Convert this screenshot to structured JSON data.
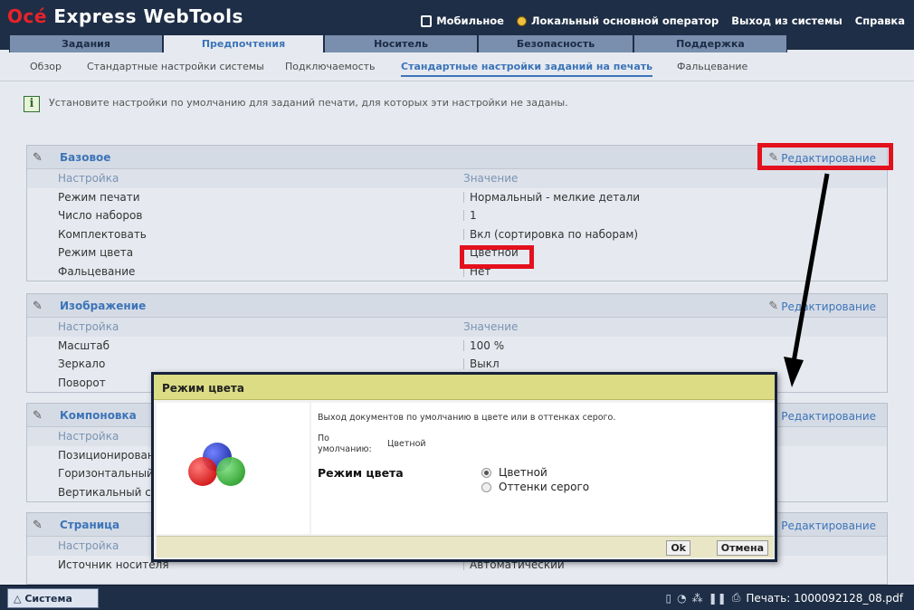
{
  "app": {
    "logo_brand": "Océ",
    "logo_product": "Express WebTools"
  },
  "topmenu": {
    "mobile": "Мобильное",
    "operator": "Локальный основной оператор",
    "logout": "Выход из системы",
    "help": "Справка"
  },
  "tabs": [
    "Задания",
    "Предпочтения",
    "Носитель",
    "Безопасность",
    "Поддержка"
  ],
  "subtabs": [
    "Обзор",
    "Стандартные настройки системы",
    "Подключаемость",
    "Стандартные настройки заданий на печать",
    "Фальцевание"
  ],
  "info_text": "Установите настройки по умолчанию для заданий печати, для которых эти настройки не заданы.",
  "edit_label": "Редактирование",
  "col_setting": "Настройка",
  "col_value": "Значение",
  "sections": {
    "basic": {
      "title": "Базовое",
      "rows": [
        {
          "k": "Режим печати",
          "v": "Нормальный - мелкие детали"
        },
        {
          "k": "Число наборов",
          "v": "1"
        },
        {
          "k": "Комплектовать",
          "v": "Вкл (сортировка по наборам)"
        },
        {
          "k": "Режим цвета",
          "v": "Цветной"
        },
        {
          "k": "Фальцевание",
          "v": "Нет"
        }
      ]
    },
    "image": {
      "title": "Изображение",
      "rows": [
        {
          "k": "Масштаб",
          "v": "100 %"
        },
        {
          "k": "Зеркало",
          "v": "Выкл"
        },
        {
          "k": "Поворот",
          "v": ""
        }
      ]
    },
    "layout": {
      "title": "Компоновка",
      "rows": [
        {
          "k": "Позиционирован",
          "v": ""
        },
        {
          "k": "Горизонтальный",
          "v": ""
        },
        {
          "k": "Вертикальный сд",
          "v": ""
        }
      ]
    },
    "page": {
      "title": "Страница",
      "rows": [
        {
          "k": "Источник носителя",
          "v": "Автоматический"
        }
      ]
    }
  },
  "dialog": {
    "title": "Режим цвета",
    "description": "Выход документов по умолчанию в цвете или в оттенках серого.",
    "default_label": "По умолчанию:",
    "default_value": "Цветной",
    "field_label": "Режим цвета",
    "options": [
      "Цветной",
      "Оттенки серого"
    ],
    "selected": "Цветной",
    "ok": "Ok",
    "cancel": "Отмена"
  },
  "statusbar": {
    "system_tab": "Система",
    "print_status": "Печать: 1000092128_08.pdf"
  },
  "colors": {
    "header_bg": "#1e2e46",
    "accent": "#3c74b8",
    "highlight_red": "#e3101d",
    "dialog_title_bg": "#dbdc84"
  }
}
